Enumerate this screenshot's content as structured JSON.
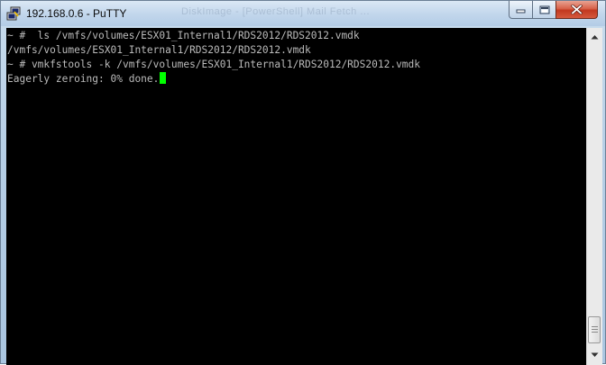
{
  "window": {
    "title": "192.168.0.6 - PuTTY",
    "ghost_title": "DiskImage - [PowerShell]  Mail  Fetch  ...",
    "icon": "putty-icon"
  },
  "controls": {
    "minimize_icon": "minimize-icon",
    "maximize_icon": "maximize-icon",
    "close_icon": "close-icon"
  },
  "terminal": {
    "lines": [
      "~ #  ls /vmfs/volumes/ESX01_Internal1/RDS2012/RDS2012.vmdk",
      "/vmfs/volumes/ESX01_Internal1/RDS2012/RDS2012.vmdk",
      "~ # vmkfstools -k /vmfs/volumes/ESX01_Internal1/RDS2012/RDS2012.vmdk",
      "Eagerly zeroing: 0% done."
    ],
    "cursor_color": "#00ff00",
    "background": "#000000",
    "foreground": "#bbbbbb"
  },
  "scrollbar": {
    "up_icon": "scroll-up-arrow-icon",
    "down_icon": "scroll-down-arrow-icon"
  }
}
